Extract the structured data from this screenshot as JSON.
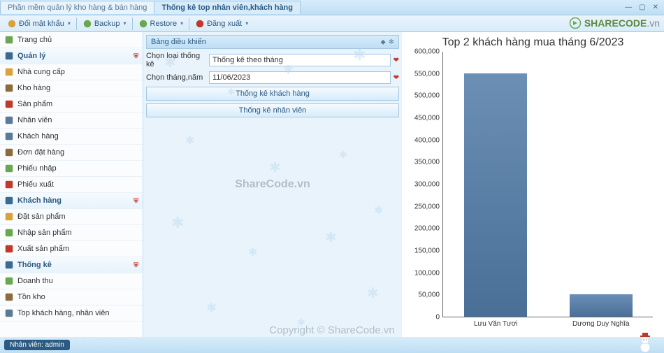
{
  "window": {
    "tabs": [
      {
        "label": "Phần mềm quản lý kho hàng & bán hàng",
        "active": false
      },
      {
        "label": "Thống kê top nhân viên,khách hàng",
        "active": true
      }
    ],
    "controls": {
      "min": "—",
      "max": "▢",
      "close": "✕"
    }
  },
  "toolbar": {
    "items": [
      {
        "icon": "lock-icon",
        "label": "Đổi mật khẩu",
        "color": "#d9a23a"
      },
      {
        "icon": "backup-icon",
        "label": "Backup",
        "color": "#6aa84f"
      },
      {
        "icon": "restore-icon",
        "label": "Restore",
        "color": "#6aa84f"
      },
      {
        "icon": "logout-icon",
        "label": "Đăng xuất",
        "color": "#c0392b"
      }
    ],
    "brand_text": "SHARECODE",
    "brand_suffix": ".vn"
  },
  "sidebar": {
    "groups": [
      {
        "icon": "home-icon",
        "label": "Trang chủ",
        "color": "#6aa84f",
        "section": false
      },
      {
        "icon": "manage-icon",
        "label": "Quản lý",
        "color": "#3a6a8f",
        "section": true,
        "badge": "⛨"
      },
      {
        "icon": "supplier-icon",
        "label": "Nhà cung cấp",
        "color": "#d9a23a",
        "section": false
      },
      {
        "icon": "warehouse-icon",
        "label": "Kho hàng",
        "color": "#8a6d3b",
        "section": false
      },
      {
        "icon": "product-icon",
        "label": "Sản phẩm",
        "color": "#c0392b",
        "section": false
      },
      {
        "icon": "employee-icon",
        "label": "Nhân viên",
        "color": "#5a7a95",
        "section": false
      },
      {
        "icon": "customer-icon",
        "label": "Khách hàng",
        "color": "#5a7a95",
        "section": false
      },
      {
        "icon": "order-icon",
        "label": "Đơn đặt hàng",
        "color": "#8a6d3b",
        "section": false
      },
      {
        "icon": "import-slip-icon",
        "label": "Phiếu nhập",
        "color": "#6aa84f",
        "section": false
      },
      {
        "icon": "export-slip-icon",
        "label": "Phiếu xuất",
        "color": "#c0392b",
        "section": false
      },
      {
        "icon": "customer2-icon",
        "label": "Khách hàng",
        "color": "#3a6a8f",
        "section": true,
        "badge": "⛨"
      },
      {
        "icon": "order2-icon",
        "label": "Đặt sản phẩm",
        "color": "#d9a23a",
        "section": false
      },
      {
        "icon": "import2-icon",
        "label": "Nhập sản phẩm",
        "color": "#6aa84f",
        "section": false
      },
      {
        "icon": "export2-icon",
        "label": "Xuất sản phẩm",
        "color": "#c0392b",
        "section": false
      },
      {
        "icon": "stats-icon",
        "label": "Thống kê",
        "color": "#3a6a8f",
        "section": true,
        "badge": "⛨"
      },
      {
        "icon": "revenue-icon",
        "label": "Doanh thu",
        "color": "#6aa84f",
        "section": false
      },
      {
        "icon": "stock-icon",
        "label": "Tồn kho",
        "color": "#8a6d3b",
        "section": false
      },
      {
        "icon": "top-icon",
        "label": "Top khách hàng, nhân viên",
        "color": "#5a7a95",
        "section": false
      }
    ]
  },
  "control_panel": {
    "header": "Bảng điều khiển",
    "row1_label": "Chọn loại thống kê",
    "row1_value": "Thống kê theo tháng",
    "row2_label": "Chọn tháng,năm",
    "row2_value": "11/06/2023",
    "btn1": "Thống kê khách hàng",
    "btn2": "Thống kê nhân viên"
  },
  "watermark_center": "ShareCode.vn",
  "watermark_bottom": "Copyright © ShareCode.vn",
  "chart_data": {
    "type": "bar",
    "title": "Top 2 khách hàng mua tháng 6/2023",
    "categories": [
      "Lưu Văn Tươi",
      "Dương Duy Nghĩa"
    ],
    "values": [
      550000,
      50000
    ],
    "ylim": [
      0,
      600000
    ],
    "ystep": 50000,
    "ylabel": "",
    "xlabel": ""
  },
  "status": {
    "label_prefix": "Nhân viên: ",
    "user": "admin"
  }
}
